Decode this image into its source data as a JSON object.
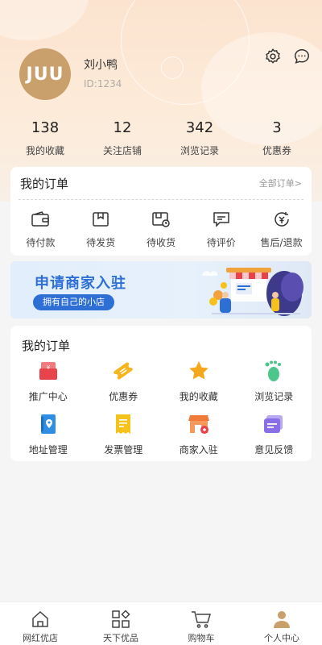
{
  "profile": {
    "avatar_text": "JUU",
    "name": "刘小鸭",
    "id_text": "ID:1234",
    "header_icons": [
      "settings-icon",
      "message-icon"
    ]
  },
  "stats": [
    {
      "value": "138",
      "label": "我的收藏"
    },
    {
      "value": "12",
      "label": "关注店铺"
    },
    {
      "value": "342",
      "label": "浏览记录"
    },
    {
      "value": "3",
      "label": "优惠券"
    }
  ],
  "orders": {
    "title": "我的订单",
    "all_link": "全部订单>",
    "items": [
      {
        "label": "待付款",
        "icon": "wallet-icon"
      },
      {
        "label": "待发货",
        "icon": "package-icon"
      },
      {
        "label": "待收货",
        "icon": "delivery-icon"
      },
      {
        "label": "待评价",
        "icon": "comment-icon"
      },
      {
        "label": "售后/退款",
        "icon": "refund-icon"
      }
    ]
  },
  "banner": {
    "title": "申请商家入驻",
    "subtitle": "拥有自己的小店"
  },
  "tools": {
    "title": "我的订单",
    "items": [
      {
        "label": "推广中心",
        "icon": "promotion-icon",
        "color": "#e8434a"
      },
      {
        "label": "优惠券",
        "icon": "coupon-icon",
        "color": "#f5b51c"
      },
      {
        "label": "我的收藏",
        "icon": "star-icon",
        "color": "#f5a81c"
      },
      {
        "label": "浏览记录",
        "icon": "footprint-icon",
        "color": "#4cc68a"
      },
      {
        "label": "地址管理",
        "icon": "address-icon",
        "color": "#2f8de4"
      },
      {
        "label": "发票管理",
        "icon": "invoice-icon",
        "color": "#f5c21c"
      },
      {
        "label": "商家入驻",
        "icon": "shop-icon",
        "color": "#f07a3a"
      },
      {
        "label": "意见反馈",
        "icon": "feedback-icon",
        "color": "#8a6ee8"
      }
    ]
  },
  "tabbar": [
    {
      "label": "网红优店",
      "icon": "home-icon",
      "active": false
    },
    {
      "label": "天下优品",
      "icon": "grid-icon",
      "active": false
    },
    {
      "label": "购物车",
      "icon": "cart-icon",
      "active": false
    },
    {
      "label": "个人中心",
      "icon": "user-icon",
      "active": true
    }
  ],
  "colors": {
    "accent_blue": "#2e6fd6",
    "avatar_bg": "#c9a06b",
    "header_bg": "#fbe3cf",
    "active_tab": "#c9a06b"
  }
}
